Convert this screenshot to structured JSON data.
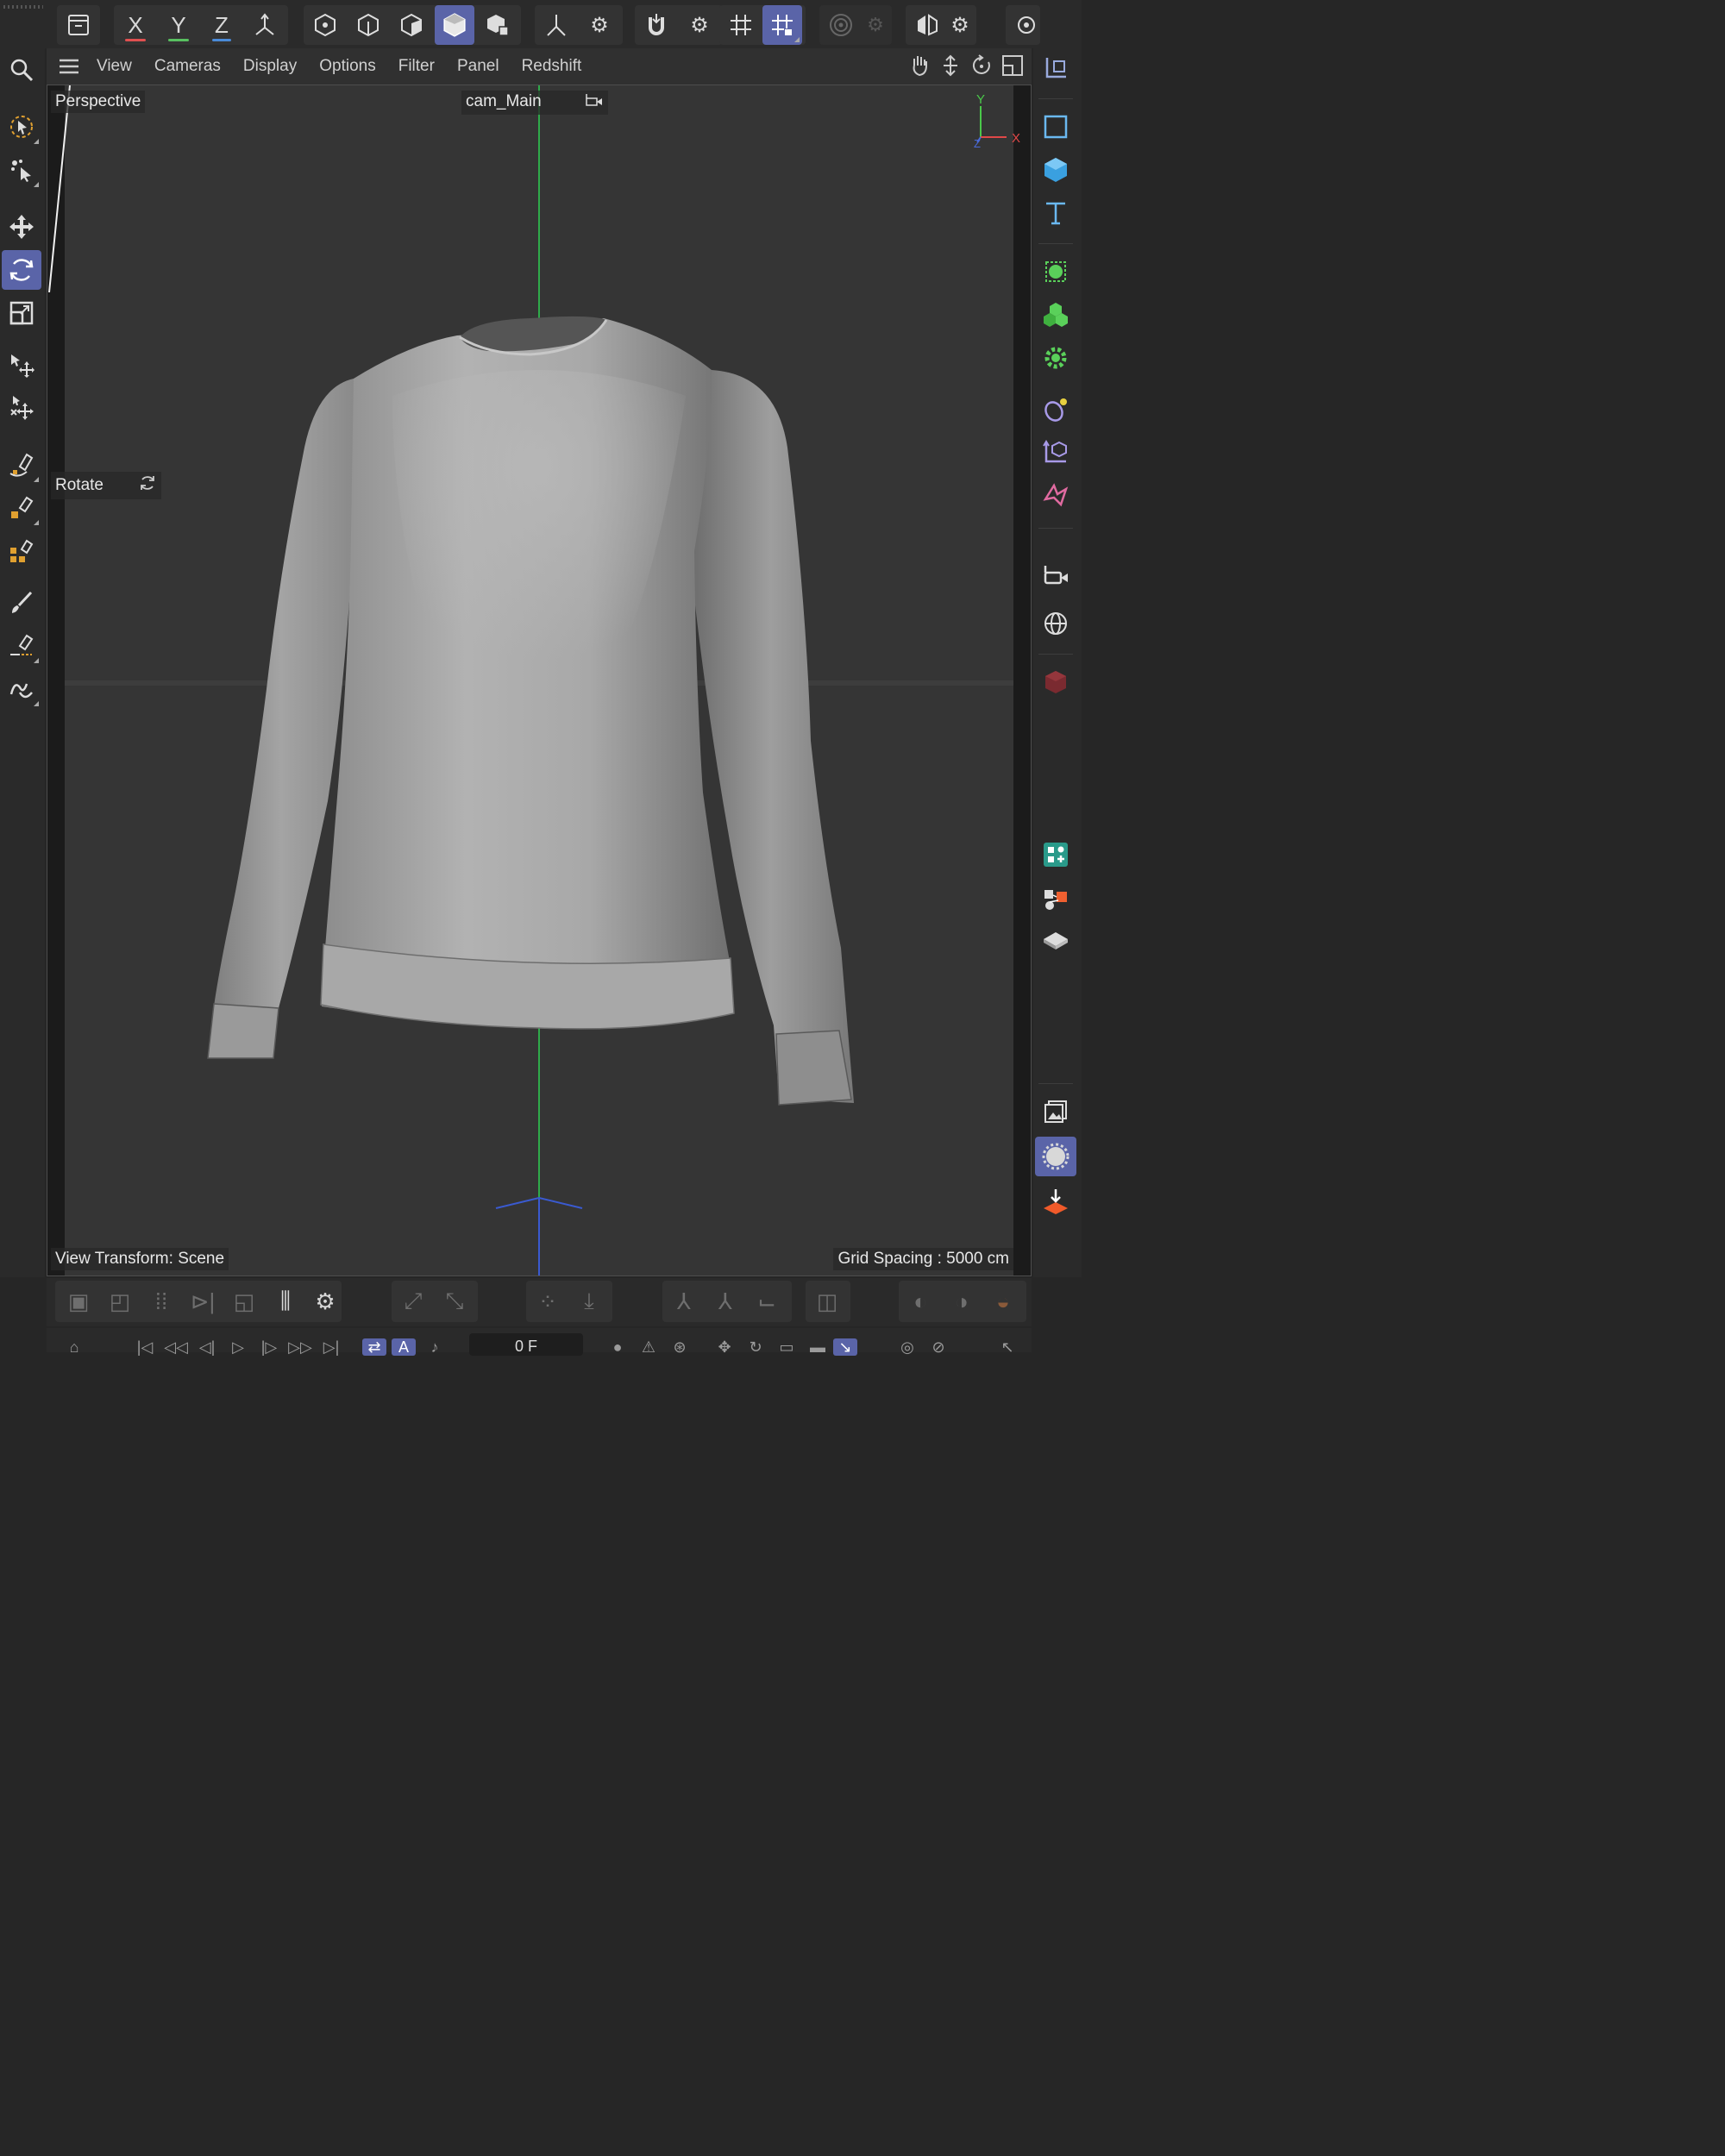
{
  "app": {
    "accent": "#5a64a8"
  },
  "top_toolbar": {
    "groups": [
      {
        "buttons": [
          "undo-archive-icon"
        ]
      },
      {
        "buttons": [
          "X",
          "Y",
          "Z",
          "coordinate-system-icon"
        ]
      },
      {
        "buttons": [
          "points-mode-icon",
          "edges-mode-icon",
          "polygons-mode-icon",
          "model-mode-icon",
          "texture-mode-icon"
        ],
        "active": "model-mode-icon"
      },
      {
        "buttons": [
          "axis-mode-icon",
          "gear-icon"
        ]
      },
      {
        "buttons": [
          "snap-magnet-icon",
          "gear-icon"
        ]
      },
      {
        "buttons": [
          "grid-snap-icon",
          "workplane-snap-icon"
        ],
        "active": "workplane-snap-icon"
      },
      {
        "buttons": [
          "soft-selection-icon",
          "gear-icon"
        ]
      },
      {
        "buttons": [
          "symmetry-icon",
          "gear-icon"
        ]
      },
      {
        "buttons": [
          "view-icon"
        ]
      }
    ]
  },
  "left_toolbar": {
    "tools": [
      "search-icon",
      "live-select-icon",
      "selection-tool-icon",
      "move-icon",
      "rotate-icon",
      "scale-icon",
      "transform-icon",
      "multi-transform-icon",
      "spline-pen-icon",
      "spline-sketch-icon",
      "spline-smooth-icon",
      "brush-icon",
      "knife-icon",
      "spline-arc-icon"
    ],
    "active": "rotate-icon"
  },
  "right_toolbar": {
    "tools": [
      "reset-axis-icon",
      "spline-rectangle-icon",
      "cube-icon",
      "text-icon",
      "subdivision-surface-icon",
      "mograph-cloner-icon",
      "deformer-gear-icon",
      "field-icon",
      "hierarchy-icon",
      "spline-wrap-icon",
      "camera-icon",
      "environment-globe-icon",
      "redshift-icon",
      "tags-icon",
      "scene-nodes-icon",
      "floor-icon",
      "picture-viewer-icon",
      "render-settings-icon",
      "render-to-po-icon"
    ],
    "active": "render-settings-icon"
  },
  "viewport": {
    "menu": [
      "View",
      "Cameras",
      "Display",
      "Options",
      "Filter",
      "Panel",
      "Redshift"
    ],
    "nav_icons": [
      "pan-icon",
      "dolly-icon",
      "orbit-icon",
      "maximize-icon"
    ],
    "projection_label": "Perspective",
    "camera_label": "cam_Main",
    "tool_hud_label": "Rotate",
    "view_transform": "View Transform: Scene",
    "grid_spacing": "Grid Spacing : 5000 cm",
    "axis_gizmo": {
      "y": "Y",
      "x": "X",
      "z": "Z"
    }
  },
  "timeline": {
    "frame_value": "0 F"
  }
}
